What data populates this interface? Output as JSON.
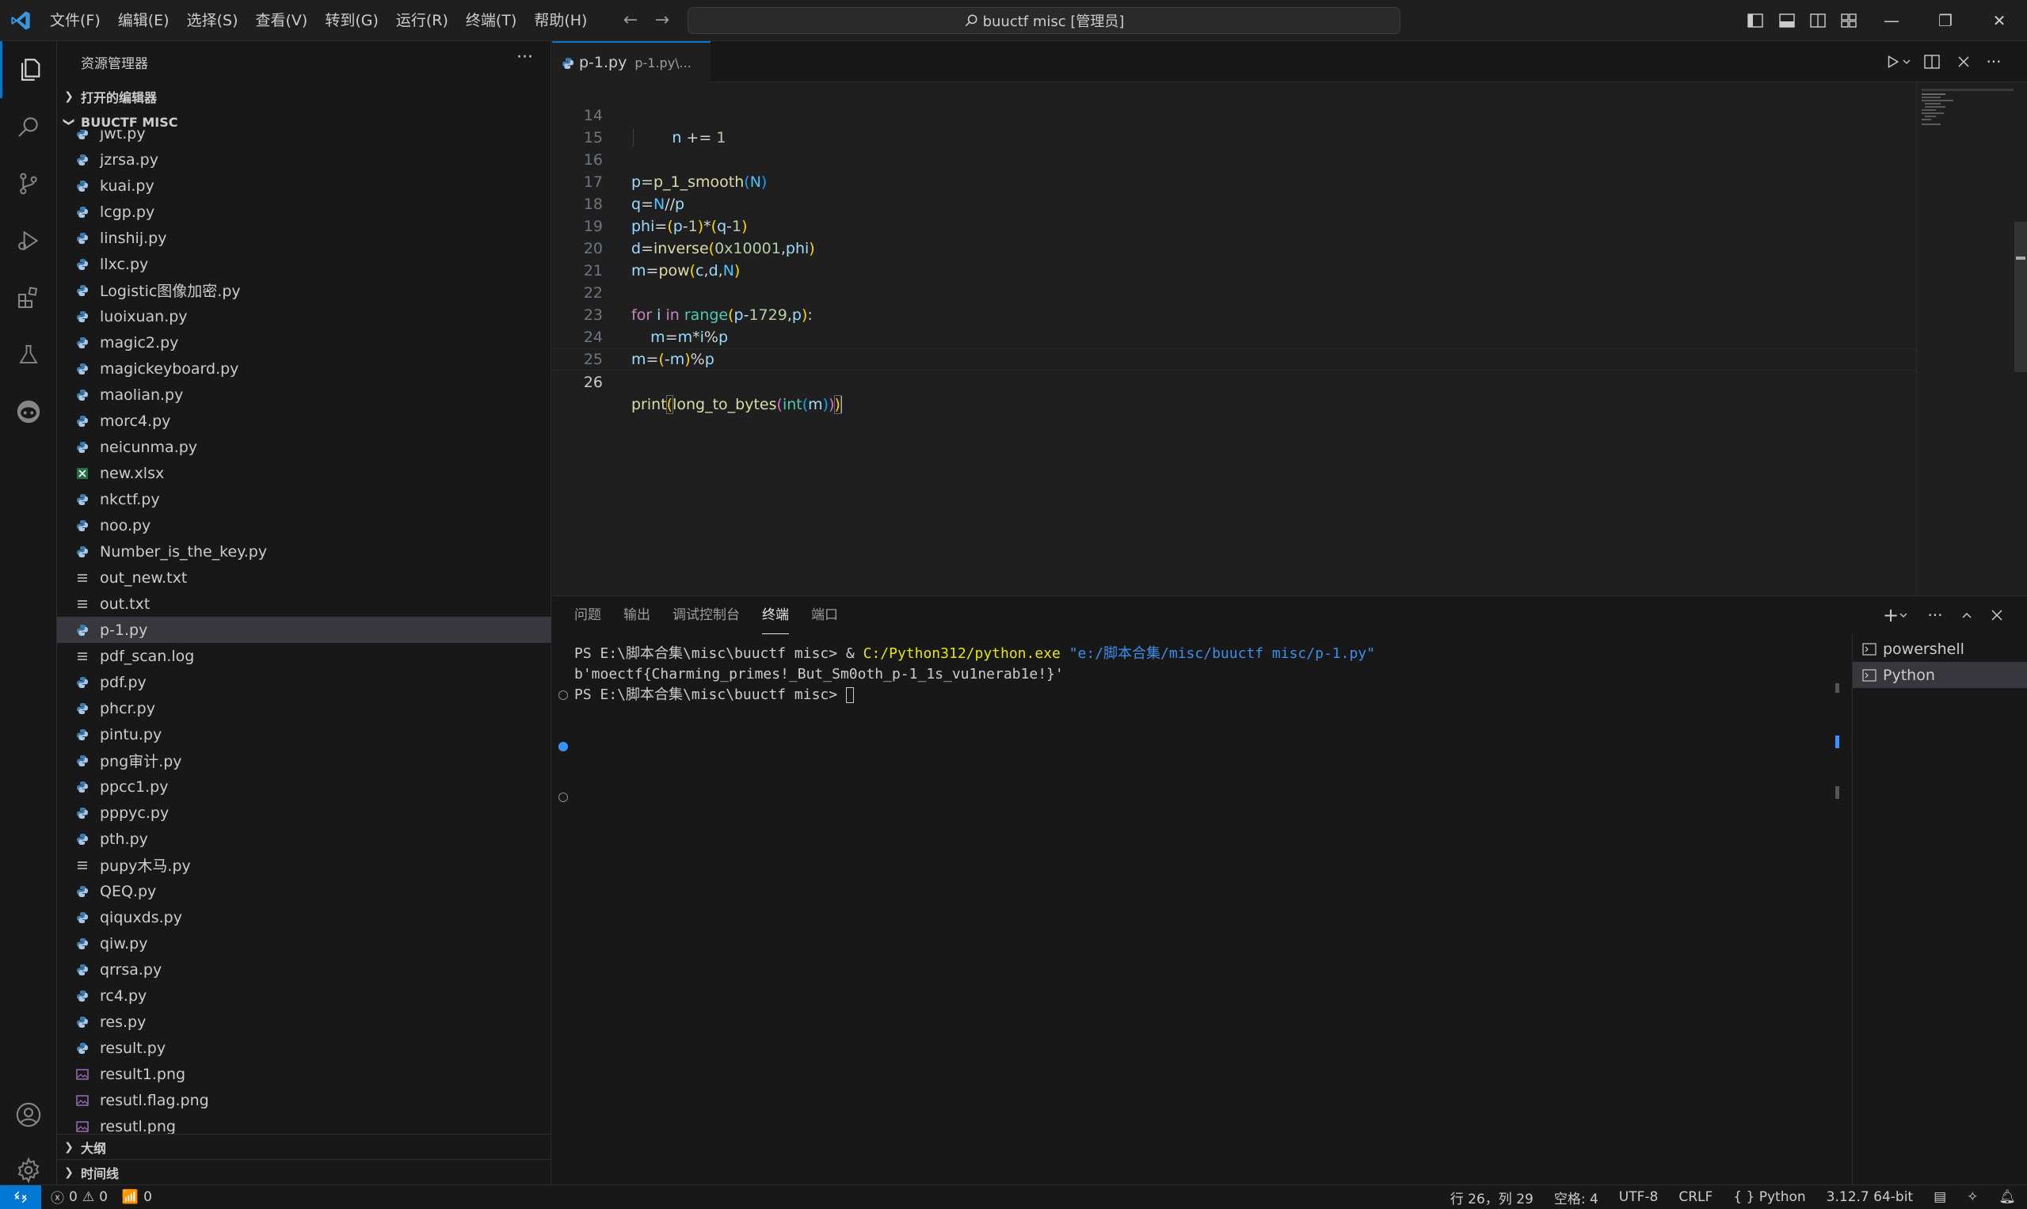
{
  "menu": [
    "文件(F)",
    "编辑(E)",
    "选择(S)",
    "查看(V)",
    "转到(G)",
    "运行(R)",
    "终端(T)",
    "帮助(H)"
  ],
  "command_center": "buuctf misc [管理员]",
  "sidebar": {
    "title": "资源管理器",
    "open_editors": "打开的编辑器",
    "folder": "BUUCTF MISC",
    "outline": "大纲",
    "timeline": "时间线",
    "files": [
      {
        "name": "jwt.py",
        "type": "py"
      },
      {
        "name": "jzrsa.py",
        "type": "py"
      },
      {
        "name": "kuai.py",
        "type": "py"
      },
      {
        "name": "lcgp.py",
        "type": "py"
      },
      {
        "name": "linshij.py",
        "type": "py"
      },
      {
        "name": "llxc.py",
        "type": "py"
      },
      {
        "name": "Logistic图像加密.py",
        "type": "py"
      },
      {
        "name": "luoixuan.py",
        "type": "py"
      },
      {
        "name": "magic2.py",
        "type": "py"
      },
      {
        "name": "magickeyboard.py",
        "type": "py"
      },
      {
        "name": "maolian.py",
        "type": "py"
      },
      {
        "name": "morc4.py",
        "type": "py"
      },
      {
        "name": "neicunma.py",
        "type": "py"
      },
      {
        "name": "new.xlsx",
        "type": "xlsx"
      },
      {
        "name": "nkctf.py",
        "type": "py"
      },
      {
        "name": "noo.py",
        "type": "py"
      },
      {
        "name": "Number_is_the_key.py",
        "type": "py"
      },
      {
        "name": "out_new.txt",
        "type": "txt"
      },
      {
        "name": "out.txt",
        "type": "txt"
      },
      {
        "name": "p-1.py",
        "type": "py",
        "selected": true
      },
      {
        "name": "pdf_scan.log",
        "type": "txt"
      },
      {
        "name": "pdf.py",
        "type": "py"
      },
      {
        "name": "phcr.py",
        "type": "py"
      },
      {
        "name": "pintu.py",
        "type": "py"
      },
      {
        "name": "png审计.py",
        "type": "py"
      },
      {
        "name": "ppcc1.py",
        "type": "py"
      },
      {
        "name": "pppyc.py",
        "type": "py"
      },
      {
        "name": "pth.py",
        "type": "py"
      },
      {
        "name": "pupy木马.py",
        "type": "txt"
      },
      {
        "name": "QEQ.py",
        "type": "py"
      },
      {
        "name": "qiquxds.py",
        "type": "py"
      },
      {
        "name": "qiw.py",
        "type": "py"
      },
      {
        "name": "qrrsa.py",
        "type": "py"
      },
      {
        "name": "rc4.py",
        "type": "py"
      },
      {
        "name": "res.py",
        "type": "py"
      },
      {
        "name": "result.py",
        "type": "py"
      },
      {
        "name": "result1.png",
        "type": "png"
      },
      {
        "name": "resutl.flag.png",
        "type": "png"
      },
      {
        "name": "resutl.png",
        "type": "png"
      }
    ]
  },
  "editor": {
    "tab_name": "p-1.py",
    "tab_desc": "p-1.py\\...",
    "line_numbers": [
      "14",
      "15",
      "16",
      "17",
      "18",
      "19",
      "20",
      "21",
      "22",
      "23",
      "24",
      "25",
      "26"
    ]
  },
  "panel": {
    "tabs": [
      "问题",
      "输出",
      "调试控制台",
      "终端",
      "端口"
    ],
    "active_tab": "终端",
    "terminal": {
      "line1_prompt": "PS E:\\脚本合集\\misc\\buuctf misc> & ",
      "line1_exe": "C:/Python312/python.exe",
      "line1_arg": " \"e:/脚本合集/misc/buuctf misc/p-1.py\"",
      "line2": "b'moectf{Charming_primes!_But_Sm0oth_p-1_1s_vu1nerab1e!}'",
      "line3_prompt": "PS E:\\脚本合集\\misc\\buuctf misc> "
    },
    "terminal_list": [
      "powershell",
      "Python"
    ]
  },
  "statusbar": {
    "errors": "0",
    "warnings": "0",
    "ports": "0",
    "position": "行 26，列 29",
    "spaces": "空格: 4",
    "encoding": "UTF-8",
    "eol": "CRLF",
    "language": "Python",
    "interpreter": "3.12.7 64-bit"
  },
  "colors": {
    "accent": "#0078d4",
    "keyword": "#c586c0",
    "function": "#dcdcaa",
    "variable": "#9cdcfe"
  }
}
